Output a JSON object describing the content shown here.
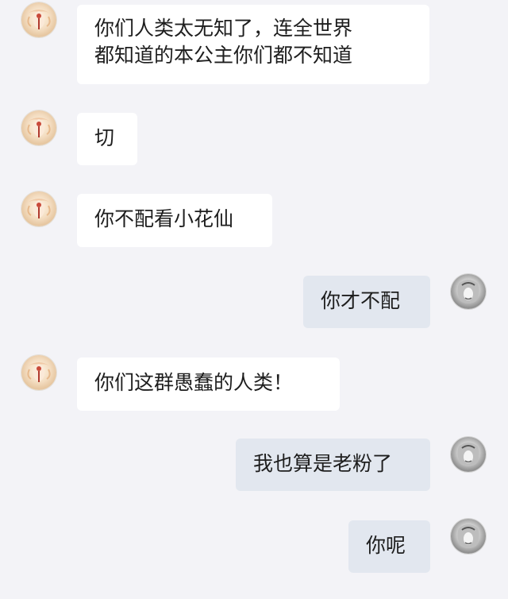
{
  "chat": {
    "messages": [
      {
        "side": "left",
        "avatar": "princess-avatar",
        "text": "你们人类太无知了，连全世界\n都知道的本公主你们都不知道"
      },
      {
        "side": "left",
        "avatar": "princess-avatar",
        "text": "切"
      },
      {
        "side": "left",
        "avatar": "princess-avatar",
        "text": "你不配看小花仙"
      },
      {
        "side": "right",
        "avatar": "user-avatar",
        "text": "你才不配"
      },
      {
        "side": "left",
        "avatar": "princess-avatar",
        "text": "你们这群愚蠢的人类！"
      },
      {
        "side": "right",
        "avatar": "user-avatar",
        "text": "我也算是老粉了"
      },
      {
        "side": "right",
        "avatar": "user-avatar",
        "text": "你呢"
      }
    ]
  },
  "colors": {
    "background": "#f3f3f7",
    "incoming_bubble": "#ffffff",
    "outgoing_bubble": "#e2e7ef",
    "text": "#1e1e1e"
  }
}
